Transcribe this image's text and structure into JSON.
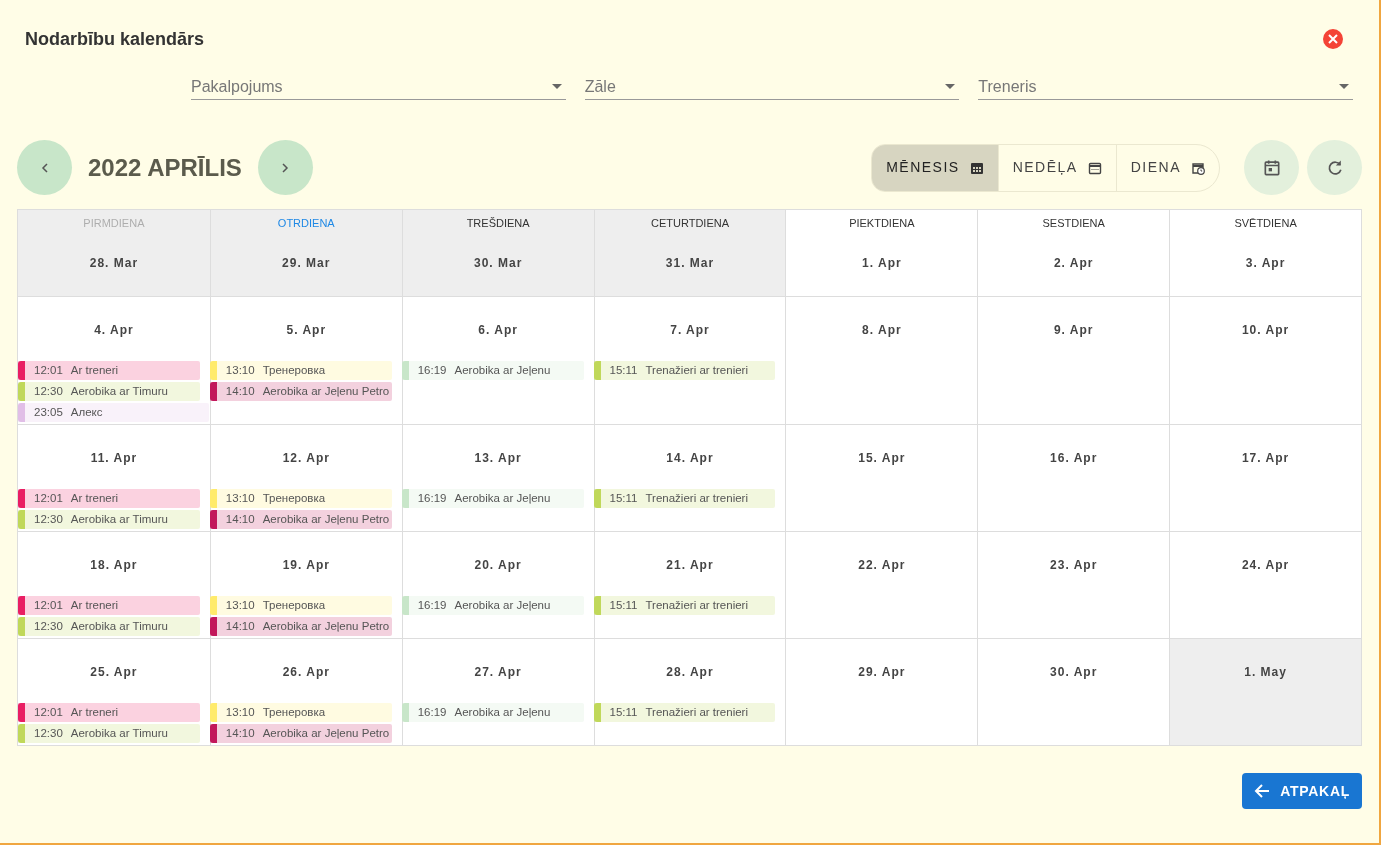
{
  "dialog": {
    "title": "Nodarbību kalendārs"
  },
  "filters": [
    {
      "placeholder": "Pakalpojums"
    },
    {
      "placeholder": "Zāle"
    },
    {
      "placeholder": "Treneris"
    }
  ],
  "toolbar": {
    "period": "2022 APRĪLIS",
    "views": [
      {
        "label": "MĒNESIS",
        "kind": "month",
        "selected": true
      },
      {
        "label": "NEDĒĻA",
        "kind": "week",
        "selected": false
      },
      {
        "label": "DIENA",
        "kind": "day",
        "selected": false
      }
    ]
  },
  "weekdays": [
    {
      "label": "PIRMDIENA",
      "muted": true,
      "today": false
    },
    {
      "label": "OTRDIENA",
      "muted": false,
      "today": true
    },
    {
      "label": "TREŠDIENA",
      "muted": false,
      "today": false
    },
    {
      "label": "CETURTDIENA",
      "muted": false,
      "today": false
    },
    {
      "label": "PIEKTDIENA",
      "muted": false,
      "today": false
    },
    {
      "label": "SESTDIENA",
      "muted": false,
      "today": false
    },
    {
      "label": "SVĒTDIENA",
      "muted": false,
      "today": false
    }
  ],
  "weeks": [
    {
      "days": [
        {
          "date": "28. Mar",
          "outside": true
        },
        {
          "date": "29. Mar",
          "outside": true
        },
        {
          "date": "30. Mar",
          "outside": true
        },
        {
          "date": "31. Mar",
          "outside": true
        },
        {
          "date": "1. Apr",
          "outside": false
        },
        {
          "date": "2. Apr",
          "outside": false
        },
        {
          "date": "3. Apr",
          "outside": false
        }
      ]
    },
    {
      "days": [
        {
          "date": "4. Apr",
          "outside": false,
          "events": [
            {
              "time": "12:01",
              "title": "Ar treneri",
              "color": "#e91e63",
              "kind": "single"
            },
            {
              "time": "12:30",
              "title": "Aerobika ar Timuru",
              "color": "#c0d85a",
              "kind": "single"
            },
            {
              "time": "23:05",
              "title": "Алекс",
              "color": "#e1bee7",
              "kind": "two-day"
            }
          ]
        },
        {
          "date": "5. Apr",
          "outside": false,
          "events": [
            {
              "time": "13:10",
              "title": "Тренеровка",
              "color": "#ffeb6b",
              "kind": "single"
            },
            {
              "time": "14:10",
              "title": "Aerobika ar Jeļenu Petro",
              "color": "#c2185b",
              "kind": "single"
            }
          ]
        },
        {
          "date": "6. Apr",
          "outside": false,
          "events": [
            {
              "time": "16:19",
              "title": "Aerobika ar Jeļenu",
              "color": "#c8e6c9",
              "kind": "single"
            }
          ]
        },
        {
          "date": "7. Apr",
          "outside": false,
          "events": [
            {
              "time": "15:11",
              "title": "Trenažieri ar trenieri",
              "color": "#c0d85a",
              "kind": "single"
            }
          ]
        },
        {
          "date": "8. Apr",
          "outside": false
        },
        {
          "date": "9. Apr",
          "outside": false
        },
        {
          "date": "10. Apr",
          "outside": false
        }
      ]
    },
    {
      "days": [
        {
          "date": "11. Apr",
          "outside": false,
          "events": [
            {
              "time": "12:01",
              "title": "Ar treneri",
              "color": "#e91e63",
              "kind": "single"
            },
            {
              "time": "12:30",
              "title": "Aerobika ar Timuru",
              "color": "#c0d85a",
              "kind": "single"
            }
          ]
        },
        {
          "date": "12. Apr",
          "outside": false,
          "events": [
            {
              "time": "13:10",
              "title": "Тренеровка",
              "color": "#ffeb6b",
              "kind": "single"
            },
            {
              "time": "14:10",
              "title": "Aerobika ar Jeļenu Petro",
              "color": "#c2185b",
              "kind": "single"
            }
          ]
        },
        {
          "date": "13. Apr",
          "outside": false,
          "events": [
            {
              "time": "16:19",
              "title": "Aerobika ar Jeļenu",
              "color": "#c8e6c9",
              "kind": "single"
            }
          ]
        },
        {
          "date": "14. Apr",
          "outside": false,
          "events": [
            {
              "time": "15:11",
              "title": "Trenažieri ar trenieri",
              "color": "#c0d85a",
              "kind": "single"
            }
          ]
        },
        {
          "date": "15. Apr",
          "outside": false
        },
        {
          "date": "16. Apr",
          "outside": false
        },
        {
          "date": "17. Apr",
          "outside": false
        }
      ]
    },
    {
      "days": [
        {
          "date": "18. Apr",
          "outside": false,
          "events": [
            {
              "time": "12:01",
              "title": "Ar treneri",
              "color": "#e91e63",
              "kind": "single"
            },
            {
              "time": "12:30",
              "title": "Aerobika ar Timuru",
              "color": "#c0d85a",
              "kind": "single"
            }
          ]
        },
        {
          "date": "19. Apr",
          "outside": false,
          "events": [
            {
              "time": "13:10",
              "title": "Тренеровка",
              "color": "#ffeb6b",
              "kind": "single"
            },
            {
              "time": "14:10",
              "title": "Aerobika ar Jeļenu Petro",
              "color": "#c2185b",
              "kind": "single"
            }
          ]
        },
        {
          "date": "20. Apr",
          "outside": false,
          "events": [
            {
              "time": "16:19",
              "title": "Aerobika ar Jeļenu",
              "color": "#c8e6c9",
              "kind": "single"
            }
          ]
        },
        {
          "date": "21. Apr",
          "outside": false,
          "events": [
            {
              "time": "15:11",
              "title": "Trenažieri ar trenieri",
              "color": "#c0d85a",
              "kind": "single"
            }
          ]
        },
        {
          "date": "22. Apr",
          "outside": false
        },
        {
          "date": "23. Apr",
          "outside": false
        },
        {
          "date": "24. Apr",
          "outside": false
        }
      ]
    },
    {
      "days": [
        {
          "date": "25. Apr",
          "outside": false,
          "events": [
            {
              "time": "12:01",
              "title": "Ar treneri",
              "color": "#e91e63",
              "kind": "single"
            },
            {
              "time": "12:30",
              "title": "Aerobika ar Timuru",
              "color": "#c0d85a",
              "kind": "single"
            }
          ]
        },
        {
          "date": "26. Apr",
          "outside": false,
          "events": [
            {
              "time": "13:10",
              "title": "Тренеровка",
              "color": "#ffeb6b",
              "kind": "single"
            },
            {
              "time": "14:10",
              "title": "Aerobika ar Jeļenu Petro",
              "color": "#c2185b",
              "kind": "single"
            }
          ]
        },
        {
          "date": "27. Apr",
          "outside": false,
          "events": [
            {
              "time": "16:19",
              "title": "Aerobika ar Jeļenu",
              "color": "#c8e6c9",
              "kind": "single"
            }
          ]
        },
        {
          "date": "28. Apr",
          "outside": false,
          "events": [
            {
              "time": "15:11",
              "title": "Trenažieri ar trenieri",
              "color": "#c0d85a",
              "kind": "single"
            }
          ]
        },
        {
          "date": "29. Apr",
          "outside": false
        },
        {
          "date": "30. Apr",
          "outside": false
        },
        {
          "date": "1. May",
          "outside": true
        }
      ]
    }
  ],
  "footer": {
    "back_button": "ATPAKAĻ"
  }
}
